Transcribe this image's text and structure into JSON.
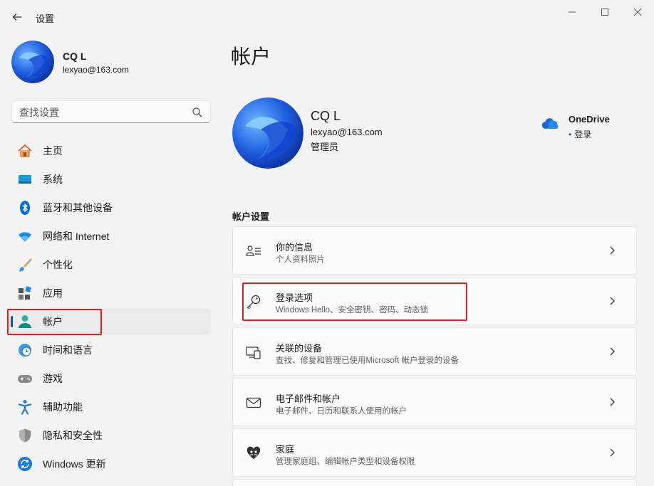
{
  "window": {
    "title": "设置",
    "controls": [
      "minimize-icon",
      "maximize-icon",
      "close-icon"
    ]
  },
  "user": {
    "name": "CQ L",
    "email": "lexyao@163.com",
    "role": "管理员"
  },
  "search": {
    "placeholder": "查找设置"
  },
  "nav": {
    "items": [
      {
        "label": "主页",
        "icon": "home-icon"
      },
      {
        "label": "系统",
        "icon": "system-icon"
      },
      {
        "label": "蓝牙和其他设备",
        "icon": "bluetooth-icon"
      },
      {
        "label": "网络和 Internet",
        "icon": "wifi-icon"
      },
      {
        "label": "个性化",
        "icon": "brush-icon"
      },
      {
        "label": "应用",
        "icon": "apps-icon"
      },
      {
        "label": "帐户",
        "icon": "account-icon",
        "active": true
      },
      {
        "label": "时间和语言",
        "icon": "clock-globe-icon"
      },
      {
        "label": "游戏",
        "icon": "gamepad-icon"
      },
      {
        "label": "辅助功能",
        "icon": "accessibility-icon"
      },
      {
        "label": "隐私和安全性",
        "icon": "shield-icon"
      },
      {
        "label": "Windows 更新",
        "icon": "update-icon"
      }
    ]
  },
  "main": {
    "title": "帐户",
    "onedrive": {
      "title": "OneDrive",
      "status": "登录"
    },
    "section_title": "帐户设置",
    "cards": [
      {
        "title": "你的信息",
        "subtitle": "个人资料照片",
        "icon": "person-info-icon"
      },
      {
        "title": "登录选项",
        "subtitle": "Windows Hello、安全密钥、密码、动态锁",
        "icon": "key-icon"
      },
      {
        "title": "关联的设备",
        "subtitle": "查找、修复和管理已使用Microsoft 帐户登录的设备",
        "icon": "linked-devices-icon"
      },
      {
        "title": "电子邮件和帐户",
        "subtitle": "电子邮件、日历和联系人使用的帐户",
        "icon": "mail-icon"
      },
      {
        "title": "家庭",
        "subtitle": "管理家庭组、编辑帐户类型和设备权限",
        "icon": "family-heart-icon"
      }
    ]
  },
  "colors": {
    "accent": "#005fb8",
    "highlight": "#e02020",
    "background": "#f3f3f3",
    "card": "#fbfbfb"
  }
}
